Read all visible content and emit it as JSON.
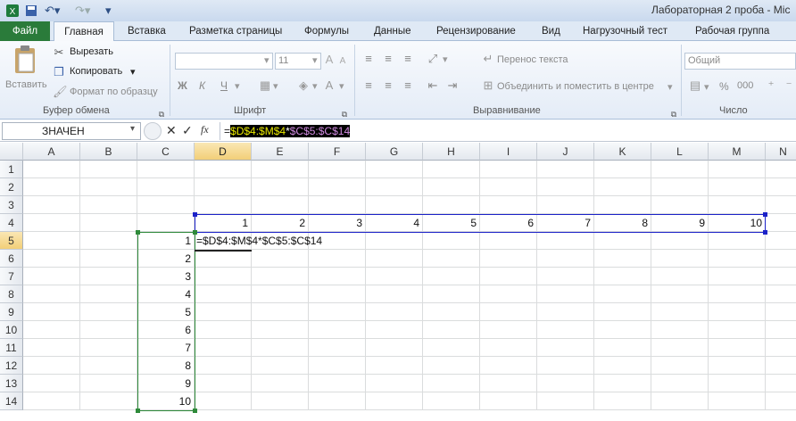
{
  "title": "Лабораторная 2 проба - Mic",
  "tabs": [
    "Файл",
    "Главная",
    "Вставка",
    "Разметка страницы",
    "Формулы",
    "Данные",
    "Рецензирование",
    "Вид",
    "Нагрузочный тест",
    "Рабочая группа"
  ],
  "clipboard": {
    "paste": "Вставить",
    "cut": "Вырезать",
    "copy": "Копировать",
    "format": "Формат по образцу",
    "label": "Буфер обмена"
  },
  "font": {
    "size": "11",
    "bold": "Ж",
    "italic": "К",
    "underline": "Ч",
    "label": "Шрифт"
  },
  "alignment": {
    "wrap": "Перенос текста",
    "merge": "Объединить и поместить в центре",
    "label": "Выравнивание"
  },
  "number": {
    "format": "Общий",
    "percent": "%",
    "thousands": "000",
    "label": "Число"
  },
  "namebox": "ЗНАЧЕН",
  "fx": "fx",
  "formula": {
    "eq": "=",
    "part1": "$D$4:$M$4",
    "op": "*",
    "part2": "$C$5:$C$14"
  },
  "cell_formula": "=$D$4:$M$4*$C$5:$C$14",
  "columns": [
    "A",
    "B",
    "C",
    "D",
    "E",
    "F",
    "G",
    "H",
    "I",
    "J",
    "K",
    "L",
    "M",
    "N"
  ],
  "rows": [
    "1",
    "2",
    "3",
    "4",
    "5",
    "6",
    "7",
    "8",
    "9",
    "10",
    "11",
    "12",
    "13",
    "14"
  ],
  "row4_values": [
    "1",
    "2",
    "3",
    "4",
    "5",
    "6",
    "7",
    "8",
    "9",
    "10"
  ],
  "colC_values": [
    "1",
    "2",
    "3",
    "4",
    "5",
    "6",
    "7",
    "8",
    "9",
    "10"
  ],
  "colors": {
    "file_tab": "#2a7b3a",
    "formula_ref1": "#e8e800",
    "formula_ref2": "#d08be0",
    "range_blue": "#1c22c8",
    "range_green": "#2f8a3a"
  }
}
